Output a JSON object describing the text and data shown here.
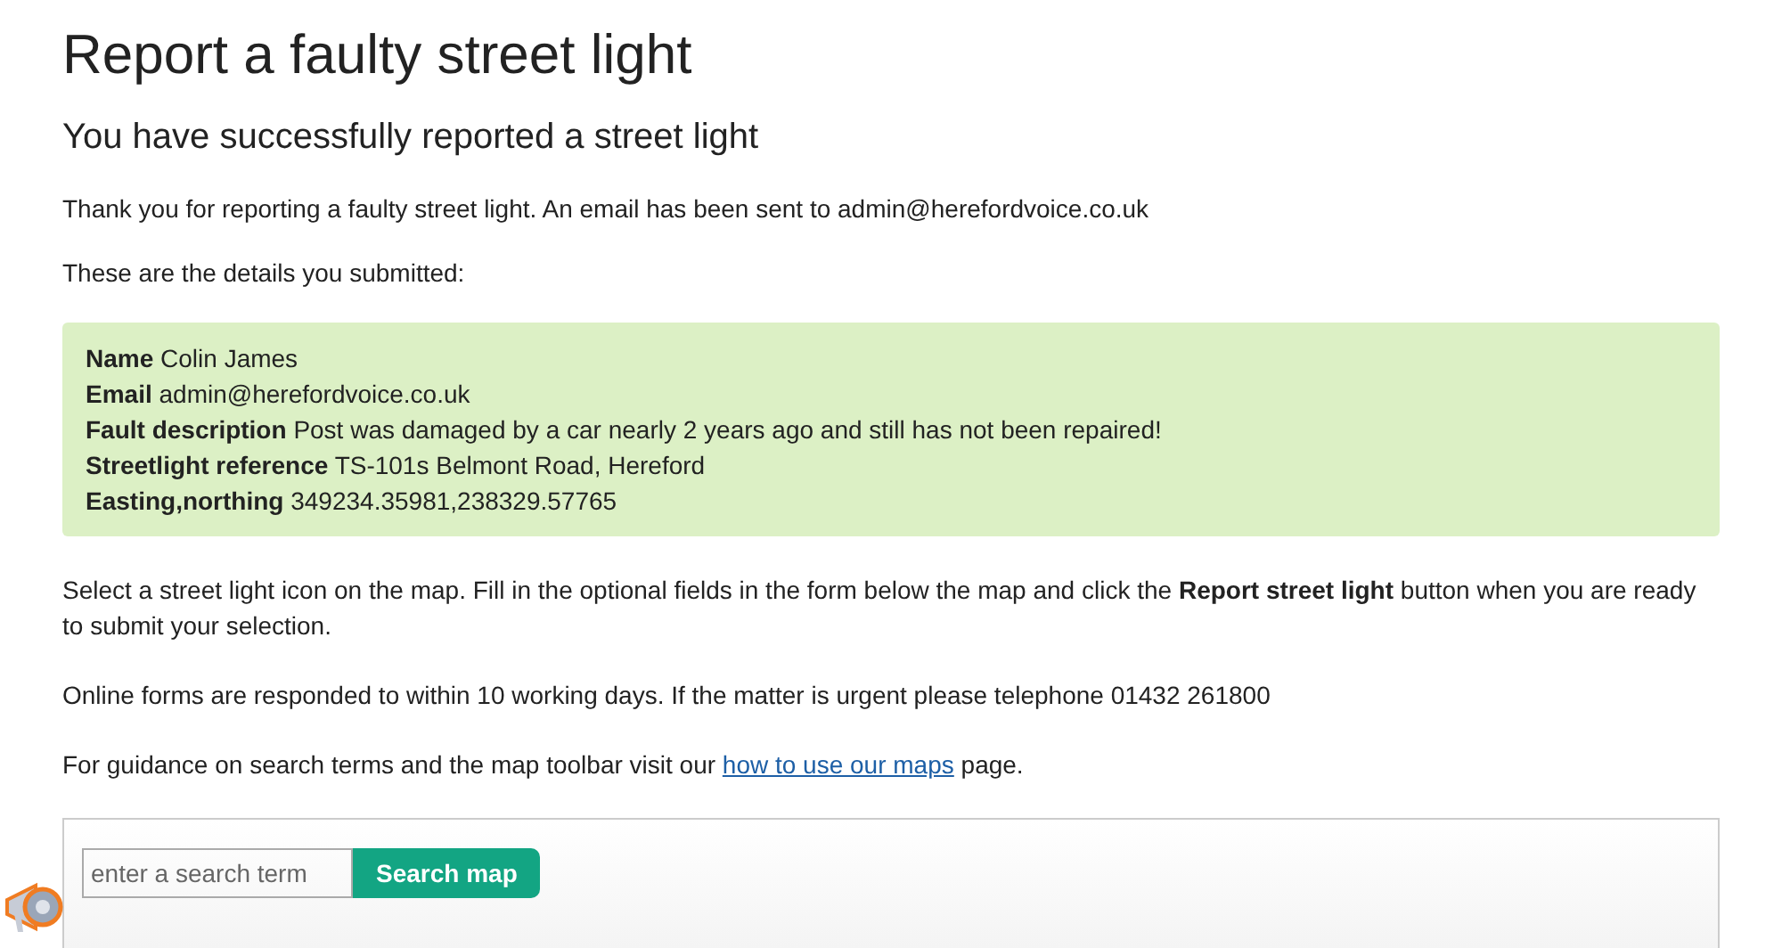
{
  "title": "Report a faulty street light",
  "subtitle": "You have successfully reported a street light",
  "intro": "Thank you for reporting a faulty street light. An email has been sent to admin@herefordvoice.co.uk",
  "details_intro": "These are the details you submitted:",
  "details": [
    {
      "label": "Name",
      "value": "Colin James"
    },
    {
      "label": "Email",
      "value": "admin@herefordvoice.co.uk"
    },
    {
      "label": "Fault description",
      "value": "Post was damaged by a car nearly 2 years ago and still has not been repaired!"
    },
    {
      "label": "Streetlight reference",
      "value": "TS-101s Belmont Road, Hereford"
    },
    {
      "label": "Easting,northing",
      "value": "349234.35981,238329.57765"
    }
  ],
  "instructions": "Select a street light icon on the map. Fill in the optional fields in the form below the map and click the **Report street light** button when you are ready to submit your selection.",
  "response_note": "Online forms are responded to within 10 working days. If the matter is urgent please telephone 01432 261800",
  "guidance": {
    "before": "For guidance on search terms and the map toolbar visit our",
    "link": "how to use our maps",
    "after": "page."
  },
  "map_search": {
    "placeholder": "enter a search term",
    "button": "Search map"
  }
}
